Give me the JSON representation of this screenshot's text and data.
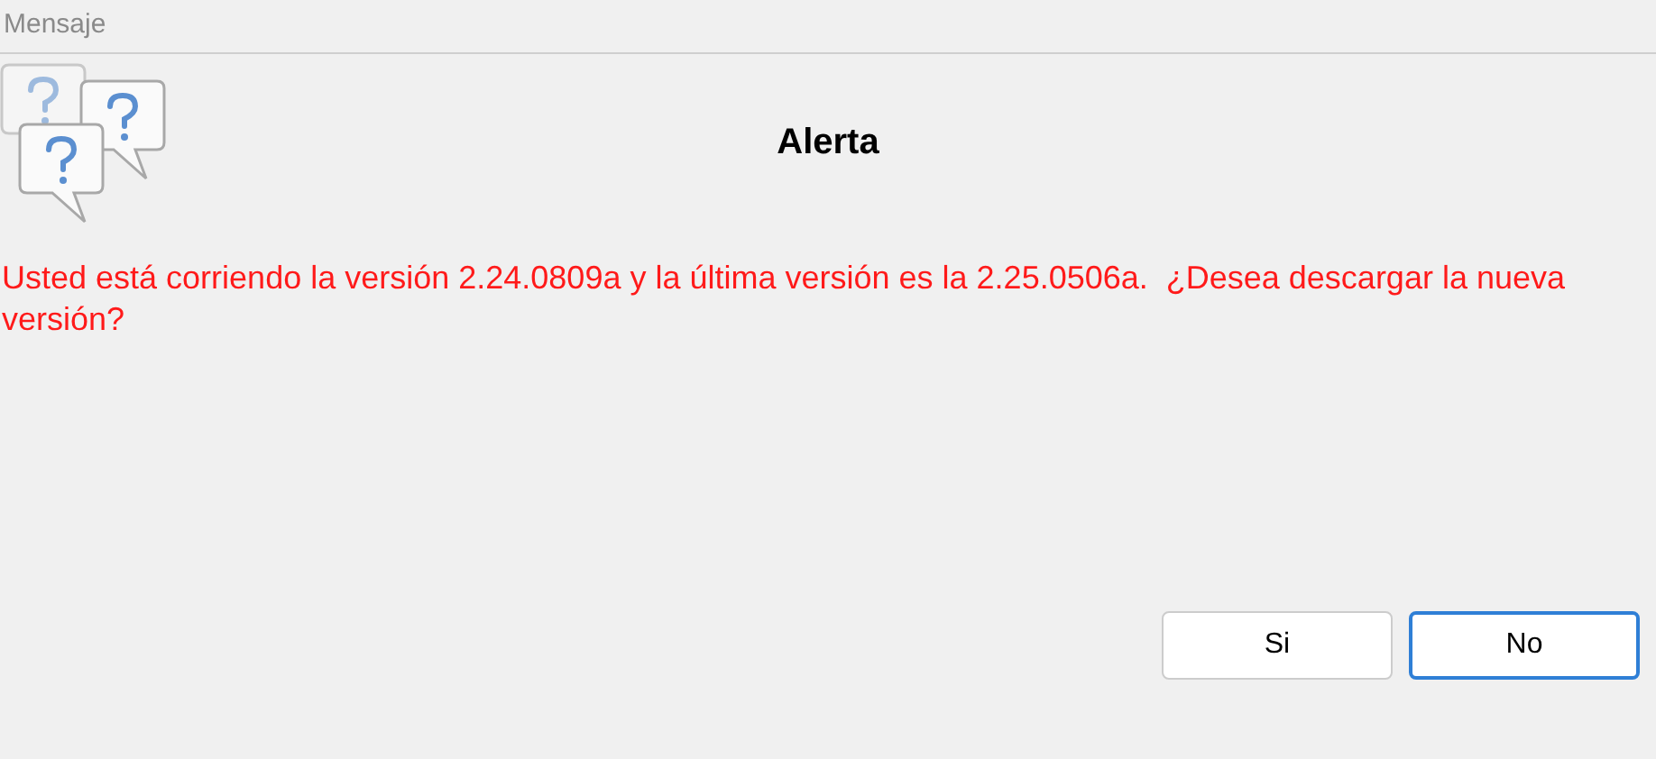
{
  "window": {
    "title": "Mensaje"
  },
  "dialog": {
    "heading": "Alerta",
    "message": "Usted está corriendo la versión 2.24.0809a y la última versión es la 2.25.0506a.  ¿Desea descargar la nueva versión?"
  },
  "buttons": [
    {
      "label": "Si",
      "focused": false
    },
    {
      "label": "No",
      "focused": true
    }
  ]
}
